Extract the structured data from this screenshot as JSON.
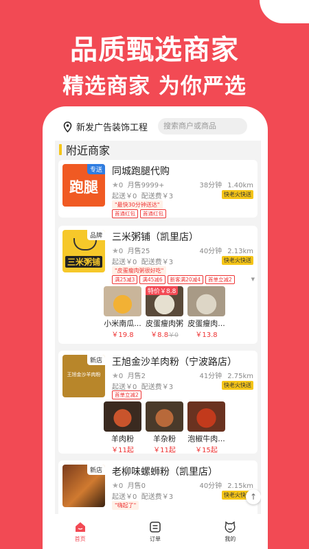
{
  "promo": {
    "headline": "品质甄选商家",
    "subheadline": "精选商家 为你严选"
  },
  "topbar": {
    "location": "新发广告装饰工程",
    "search_placeholder": "搜索商户或商品"
  },
  "section_title": "附近商家",
  "shops": [
    {
      "name": "同城跑腿代购",
      "thumb_text": "跑腿",
      "badge": "专送",
      "rating": "0",
      "sold": "月售9999+",
      "time": "38分钟",
      "distance": "1.40km",
      "min_order": "起送￥0",
      "delivery_fee": "配送费￥3",
      "express": "快老火快送",
      "promo": "\"最快30分钟送达\"",
      "coupons": [
        "首通红包",
        "首通红包"
      ],
      "dishes": []
    },
    {
      "name": "三米粥铺（凯里店）",
      "thumb_text": "三米粥铺",
      "badge": "品牌",
      "rating": "0",
      "sold": "月售25",
      "time": "40分钟",
      "distance": "2.13km",
      "min_order": "起送￥0",
      "delivery_fee": "配送费￥3",
      "express": "快老火快送",
      "promo": "\"皮蛋瘦肉粥很好吃\"",
      "coupons": [
        "满25减3",
        "满45减6",
        "新客满20减4",
        "首单立减2"
      ],
      "dishes": [
        {
          "name": "小米南瓜...",
          "price": "￥19.8",
          "old_price": "",
          "badge": ""
        },
        {
          "name": "皮蛋瘦肉粥",
          "price": "￥8.8",
          "old_price": "￥0",
          "badge": "特价￥8.8"
        },
        {
          "name": "皮蛋瘦肉...",
          "price": "￥13.8",
          "old_price": "",
          "badge": ""
        }
      ]
    },
    {
      "name": "王旭金沙羊肉粉（宁波路店）",
      "thumb_text": "王旭金沙羊肉粉",
      "badge": "新店",
      "rating": "0",
      "sold": "月售2",
      "time": "41分钟",
      "distance": "2.75km",
      "min_order": "起送￥0",
      "delivery_fee": "配送费￥3",
      "express": "快老火快送",
      "promo": "",
      "coupons": [
        "首单立减2"
      ],
      "dishes": [
        {
          "name": "羊肉粉",
          "price": "￥11起",
          "old_price": "",
          "badge": ""
        },
        {
          "name": "羊杂粉",
          "price": "￥11起",
          "old_price": "",
          "badge": ""
        },
        {
          "name": "泡椒牛肉...",
          "price": "￥15起",
          "old_price": "",
          "badge": ""
        }
      ]
    },
    {
      "name": "老柳味螺蛳粉（凯里店）",
      "thumb_text": "",
      "badge": "新店",
      "rating": "0",
      "sold": "月售0",
      "time": "40分钟",
      "distance": "2.15km",
      "min_order": "起送￥0",
      "delivery_fee": "配送费￥3",
      "express": "快老火快送",
      "promo": "\"嗨起了\"",
      "coupons": [],
      "dishes": []
    }
  ],
  "tabs": [
    {
      "label": "首页",
      "icon": "home-icon",
      "active": true
    },
    {
      "label": "订单",
      "icon": "order-icon",
      "active": false
    },
    {
      "label": "我的",
      "icon": "profile-icon",
      "active": false
    }
  ],
  "colors": {
    "brand": "#f24a54",
    "accent": "#f5c518"
  }
}
